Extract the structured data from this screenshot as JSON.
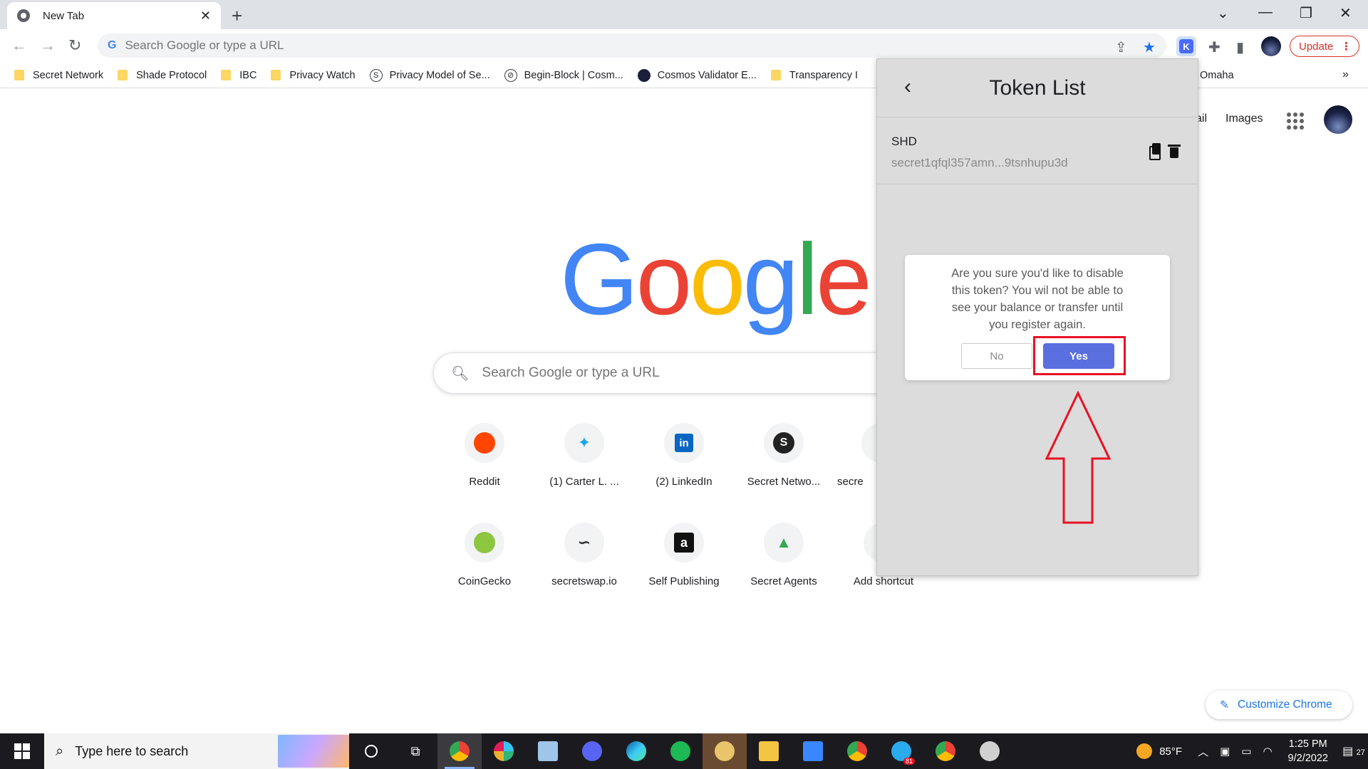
{
  "browser": {
    "tab_title": "New Tab",
    "tab_close": "✕",
    "new_tab": "+",
    "omnibox_placeholder": "Search Google or type a URL",
    "update_label": "Update",
    "update_menu": "⋮"
  },
  "bookmarks": {
    "items": [
      {
        "label": "Secret Network",
        "icon": "folder-icon"
      },
      {
        "label": "Shade Protocol",
        "icon": "folder-icon"
      },
      {
        "label": "IBC",
        "icon": "folder-icon"
      },
      {
        "label": "Privacy Watch",
        "icon": "folder-icon"
      },
      {
        "label": "Privacy Model of Se...",
        "icon": "secret-s-icon"
      },
      {
        "label": "Begin-Block | Cosm...",
        "icon": "slash-circle-icon"
      },
      {
        "label": "Cosmos Validator E...",
        "icon": "cosmos-icon"
      },
      {
        "label": "Transparency I",
        "icon": "folder-icon"
      }
    ],
    "overflow_item": "Omaha",
    "more": "»"
  },
  "google": {
    "top_links": {
      "mail": "ail",
      "images": "Images"
    },
    "logo_letters": [
      {
        "char": "G",
        "color": "#4285F4"
      },
      {
        "char": "o",
        "color": "#EA4335"
      },
      {
        "char": "o",
        "color": "#FBBC05"
      },
      {
        "char": "g",
        "color": "#4285F4"
      },
      {
        "char": "l",
        "color": "#34A853"
      },
      {
        "char": "e",
        "color": "#EA4335"
      }
    ],
    "search_placeholder": "Search Google or type a URL",
    "shortcuts_row1": [
      {
        "label": "Reddit",
        "glyph": "●",
        "color": "#ff4500"
      },
      {
        "label": "(1) Carter L. ...",
        "glyph": "🐦",
        "color": "#1da1f2"
      },
      {
        "label": "(2) LinkedIn",
        "glyph": "in",
        "color": "#0a66c2"
      },
      {
        "label": "Secret Netwo...",
        "glyph": "S",
        "color": "#222222"
      },
      {
        "label": "secre",
        "glyph": "",
        "color": "#1a73e8"
      }
    ],
    "shortcuts_row2": [
      {
        "label": "CoinGecko",
        "glyph": "●",
        "color": "#8dc63f"
      },
      {
        "label": "secretswap.io",
        "glyph": "∽",
        "color": "#333333"
      },
      {
        "label": "Self Publishing",
        "glyph": "a",
        "color": "#111111"
      },
      {
        "label": "Secret Agents",
        "glyph": "▲",
        "color": "#34a853"
      },
      {
        "label": "Add shortcut",
        "glyph": "",
        "color": "#5f6368"
      }
    ],
    "customize_label": "Customize Chrome"
  },
  "extension": {
    "title": "Token List",
    "back": "‹",
    "token": {
      "symbol": "SHD",
      "address": "secret1qfql357amn...9tsnhupu3d"
    },
    "dialog": {
      "message": "Are you sure you'd like to disable this token? You wil not be able to see your balance or transfer until you register again.",
      "no_label": "No",
      "yes_label": "Yes"
    },
    "annotation_color": "#e81123"
  },
  "taskbar": {
    "search_placeholder": "Type here to search",
    "weather": "85°F",
    "time": "1:25 PM",
    "date": "9/2/2022",
    "notification_count": "27",
    "telegram_badge": "81"
  }
}
